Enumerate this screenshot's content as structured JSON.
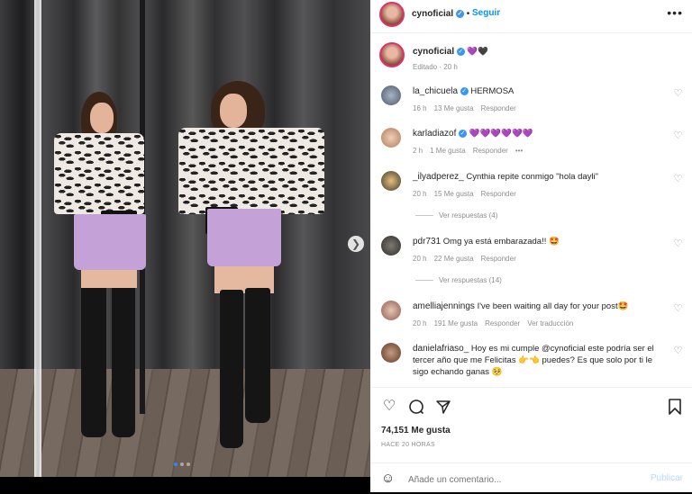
{
  "post": {
    "username": "cynoficial",
    "follow_label": "Seguir",
    "caption": "💜🖤",
    "caption_meta": "Editado · 20 h",
    "photo_dots_count": 3
  },
  "comments": [
    {
      "user": "la_chicuela",
      "verified": true,
      "text": "HERMOSA",
      "time": "16 h",
      "likes": "13 Me gusta",
      "reply": "Responder",
      "extra": ""
    },
    {
      "user": "karladiazof",
      "verified": true,
      "text": "💜💜💜💜💜💜",
      "time": "2 h",
      "likes": "1 Me gusta",
      "reply": "Responder",
      "extra": "•••"
    },
    {
      "user": "_ilyadperez_",
      "verified": false,
      "text": "Cynthia repite conmigo \"hola dayli\"",
      "time": "20 h",
      "likes": "15 Me gusta",
      "reply": "Responder",
      "extra": "",
      "replies": "Ver respuestas (4)"
    },
    {
      "user": "pdr731",
      "verified": false,
      "text": "Omg ya está embarazada!! 🤩",
      "time": "20 h",
      "likes": "22 Me gusta",
      "reply": "Responder",
      "extra": "",
      "replies": "Ver respuestas (14)"
    },
    {
      "user": "amelliajennings",
      "verified": false,
      "text": "I've been waiting all day for your post🤩",
      "time": "20 h",
      "likes": "191 Me gusta",
      "reply": "Responder",
      "extra": "Ver traducción"
    },
    {
      "user": "danielafriaso_",
      "verified": false,
      "text": "Hoy es mi cumple @cynoficial este podría ser el tercer año que me Felicitas 👉👈 puedes? Es que solo por ti le sigo echando ganas 🥺",
      "time": "",
      "likes": "",
      "reply": "",
      "extra": ""
    }
  ],
  "actions": {
    "likes": "74,151 Me gusta",
    "ago": "HACE 20 HORAS",
    "comment_placeholder": "Añade un comentario...",
    "post_label": "Publicar"
  },
  "icons": [
    "heart-icon",
    "comment-icon",
    "share-icon",
    "bookmark-icon",
    "emoji-icon",
    "more-icon",
    "chevron-right-icon"
  ],
  "colors": {
    "link": "#0095f6",
    "verified": "#3897f0",
    "muted": "#8e8e8e",
    "publish_disabled": "#b3dbff"
  }
}
